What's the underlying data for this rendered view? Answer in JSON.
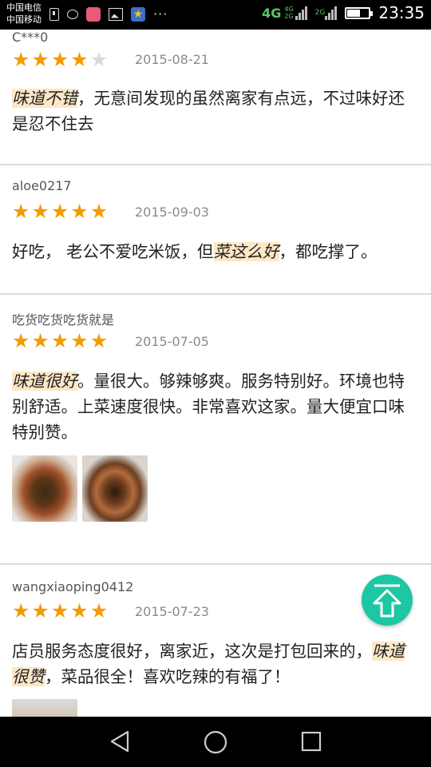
{
  "status_bar": {
    "carrier1": "中国电信",
    "carrier2": "中国移动",
    "icons": [
      "sim-icon",
      "message-icon",
      "app-icon",
      "gallery-icon",
      "star-app-icon",
      "more-icon"
    ],
    "network": "4G",
    "network_small_1": "4G",
    "network_small_2": "2G",
    "network_2g_label": "2G",
    "battery_level": 0.55,
    "time": "23:35"
  },
  "reviews": [
    {
      "username": "C***0",
      "rating": 4,
      "date": "2015-08-21",
      "highlight": "味道不错",
      "text_rest": "，无意间发现的虽然离家有点远，不过味好还是忍不住去"
    },
    {
      "username": "aloe0217",
      "rating": 5,
      "date": "2015-09-03",
      "text_before": "好吃， 老公不爱吃米饭，但",
      "highlight": "菜这么好",
      "text_after": "，都吃撑了。"
    },
    {
      "username": "吃货吃货吃货就是",
      "rating": 5,
      "date": "2015-07-05",
      "highlight": "味道很好",
      "text_rest": "。量很大。够辣够爽。服务特别好。环境也特别舒适。上菜速度很快。非常喜欢这家。量大便宜口味特别赞。",
      "photos": [
        "food-photo-1",
        "food-photo-2"
      ]
    },
    {
      "username": "wangxiaoping0412",
      "rating": 5,
      "date": "2015-07-23",
      "text_before": "店员服务态度很好，离家近，这次是打包回来的，",
      "highlight": "味道很赞",
      "text_after": "，菜品很全！喜欢吃辣的有福了！"
    }
  ],
  "scroll_top_icon": "arrow-up-icon",
  "nav": {
    "back_icon": "back-triangle-icon",
    "home_icon": "home-circle-icon",
    "recents_icon": "recents-square-icon"
  },
  "colors": {
    "star": "#f59b00",
    "highlight_bg": "#fde7c7",
    "accent": "#1ec7a3"
  }
}
